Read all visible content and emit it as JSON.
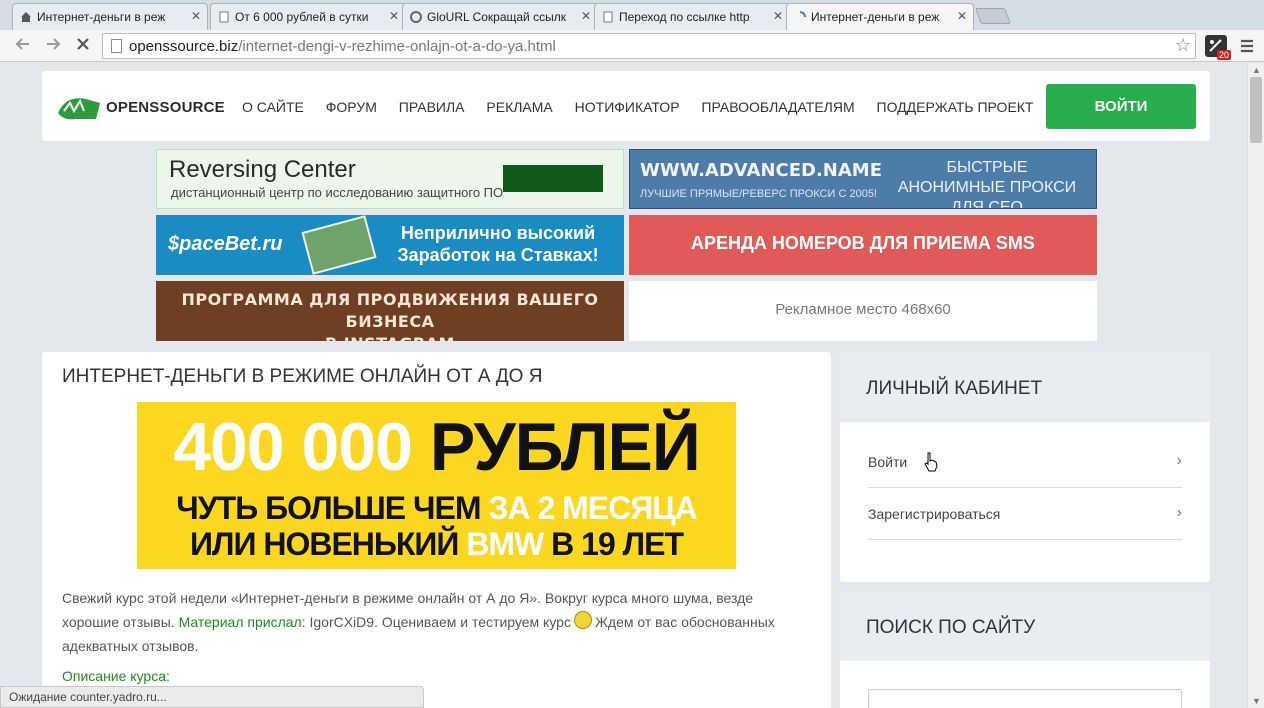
{
  "browser": {
    "tabs": [
      {
        "title": "Интернет-деньги в реж",
        "icon": "home-icon"
      },
      {
        "title": "От 6 000 рублей в сутки",
        "icon": "page-icon"
      },
      {
        "title": "GloURL Сокращай ссылк",
        "icon": "g-icon"
      },
      {
        "title": "Переход по ссылке http",
        "icon": "page-icon"
      },
      {
        "title": "Интернет-деньги в реж",
        "icon": "loading-spinner-icon"
      }
    ],
    "url_host": "openssource.biz",
    "url_path": "/internet-dengi-v-rezhime-onlajn-ot-a-do-ya.html",
    "extension_badge": "20",
    "status_text": "Ожидание counter.yadro.ru..."
  },
  "site": {
    "logo_text": "OPENSSOURCE",
    "nav": [
      "О САЙТЕ",
      "ФОРУМ",
      "ПРАВИЛА",
      "РЕКЛАМА",
      "НОТИФИКАТОР",
      "ПРАВООБЛАДАТЕЛЯМ",
      "ПОДДЕРЖАТЬ ПРОЕКТ"
    ],
    "login_label": "ВОЙТИ",
    "accent": "#27ad4c"
  },
  "banners": {
    "reversing": {
      "title": "Reversing Center",
      "subtitle": "дистанционный центр по исследованию защитного ПО"
    },
    "advanced": {
      "domain": "WWW.ADVANCED.NAME",
      "tagline": "ЛУЧШИЕ ПРЯМЫЕ/РЕВЕРС ПРОКСИ С 2005!",
      "right": "БЫСТРЫЕ АНОНИМНЫЕ ПРОКСИ ДЛЯ СЕО"
    },
    "spacebet": {
      "brand": "$paceBet.ru",
      "slogan": "Неприлично высокий Заработок на Ставках!"
    },
    "sms": {
      "text": "АРЕНДА НОМЕРОВ ДЛЯ ПРИЕМА SMS"
    },
    "instagram": {
      "line1": "ПРОГРАММА ДЛЯ ПРОДВИЖЕНИЯ ВАШЕГО БИЗНЕСА",
      "line2": "В INSTAGRAM"
    },
    "adslot": {
      "text": "Рекламное место 468x60"
    }
  },
  "article": {
    "title": "ИНТЕРНЕТ-ДЕНЬГИ В РЕЖИМЕ ОНЛАЙН ОТ А ДО Я",
    "promo": {
      "line1_white": "400 000",
      "line1_black": "РУБЛЕЙ",
      "line2_black": "ЧУТЬ БОЛЬШЕ ЧЕМ",
      "line2_white": "ЗА 2 МЕСЯЦА",
      "line3_black_a": "ИЛИ НОВЕНЬКИЙ",
      "line3_white": "BMW",
      "line3_black_b": "В 19 ЛЕТ"
    },
    "body_1": "Свежий курс этой недели «Интернет-деньги в режиме онлайн от А до Я». Вокруг курса много шума, везде хорошие отзывы.",
    "sender_label": "Материал прислал:",
    "sender": "IgorCXiD9.",
    "body_2": "Оцениваем и тестируем курс",
    "body_3": "Ждем от вас обоснованных адекватных отзывов.",
    "desc_heading": "Описание курса:"
  },
  "sidebar": {
    "cabinet_title": "ЛИЧНЫЙ КАБИНЕТ",
    "login_link": "Войти",
    "register_link": "Зарегистрироваться",
    "search_title": "ПОИСК ПО САЙТУ"
  }
}
